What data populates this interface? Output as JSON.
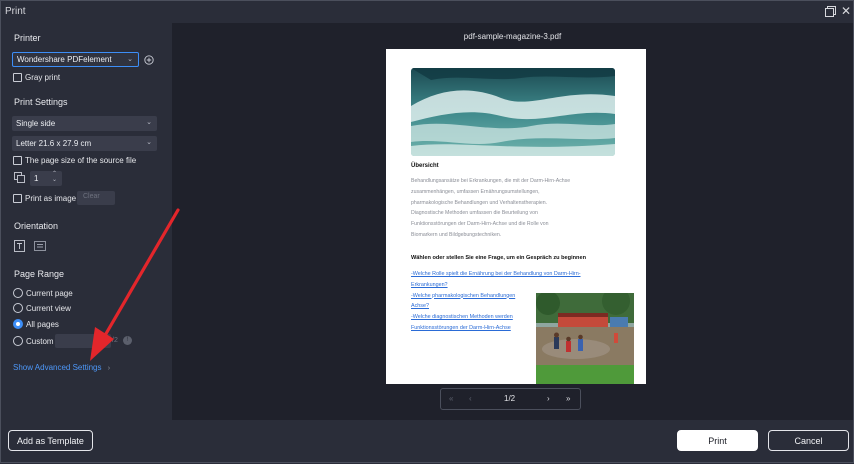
{
  "window": {
    "title": "Print"
  },
  "printer": {
    "section_label": "Printer",
    "selected": "Wondershare PDFelement",
    "gray_print_label": "Gray print"
  },
  "print_settings": {
    "section_label": "Print Settings",
    "sides": "Single side",
    "paper_size": "Letter 21.6 x 27.9 cm",
    "source_page_size_label": "The page size of the source file",
    "copies": "1",
    "print_as_image_label": "Print as image",
    "image_quality_placeholder": "Clear"
  },
  "orientation": {
    "section_label": "Orientation"
  },
  "page_range": {
    "section_label": "Page Range",
    "options": [
      "Current page",
      "Current view",
      "All pages",
      "Custom"
    ],
    "selected": "All pages",
    "custom_total": "/2"
  },
  "advanced_link": "Show Advanced Settings",
  "preview": {
    "filename": "pdf-sample-magazine-3.pdf",
    "doc_heading": "Übersicht",
    "doc_paragraph_lines": [
      "Behandlungsansätze bei Erkrankungen, die mit der Darm-Hirn-Achse",
      "zusammenhängen, umfassen Ernährungsumstellungen,",
      "pharmakologische Behandlungen und Verhaltenstherapien.",
      "Diagnostische Methoden umfassen die Beurteilung von",
      "Funktionsstörungen der Darm-Hirn-Achse und die Rolle von",
      "Biomarkern und Bildgebungstechniken."
    ],
    "doc_question_heading": "Wählen oder stellen Sie eine Frage, um ein Gespräch zu beginnen",
    "doc_links": [
      "-Welche Rolle spielt die Ernährung bei der Behandlung von Darm-Hirn-",
      "Erkrankungen?",
      "-Welche pharmakologischen Behandlungen",
      "Achse?",
      "-Welche diagnostischen Methoden werden",
      "Funktionsstörungen der Darm-Hirn-Achse"
    ],
    "page_indicator": "1/2"
  },
  "footer": {
    "template_button": "Add as Template",
    "print_button": "Print",
    "cancel_button": "Cancel"
  },
  "colors": {
    "accent": "#3d8ef7",
    "annotation_arrow": "#e3262b"
  }
}
